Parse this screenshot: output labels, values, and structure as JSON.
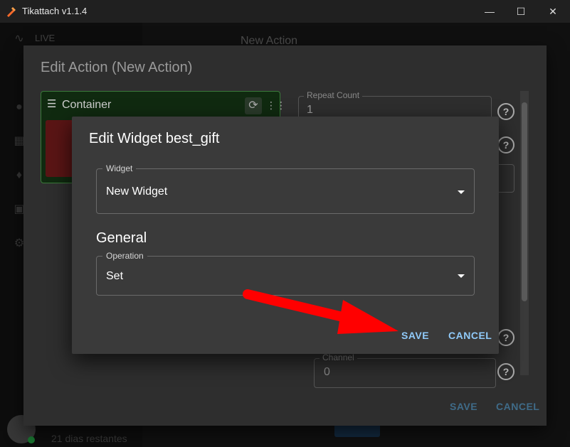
{
  "window": {
    "title": "Tikattach v1.1.4",
    "minimize_icon": "minimize-icon",
    "maximize_icon": "maximize-icon",
    "close_icon": "close-icon"
  },
  "sidebar": {
    "live_label": "LIVE"
  },
  "topbar": {
    "title": "New Action"
  },
  "user": {
    "days_left": "21 dias restantes"
  },
  "outer_dialog": {
    "title": "Edit Action (New Action)",
    "container_label": "Container",
    "repeat_count_label": "Repeat Count",
    "repeat_count_value": "1",
    "channel_label": "Channel",
    "channel_value": "0",
    "save_label": "SAVE",
    "cancel_label": "CANCEL"
  },
  "inner_dialog": {
    "title": "Edit Widget best_gift",
    "widget_label": "Widget",
    "widget_value": "New Widget",
    "section_title": "General",
    "operation_label": "Operation",
    "operation_value": "Set",
    "save_label": "SAVE",
    "cancel_label": "CANCEL"
  },
  "colors": {
    "accent": "#90caf9",
    "arrow": "#ff0000",
    "container_border": "#3a7a3a"
  }
}
